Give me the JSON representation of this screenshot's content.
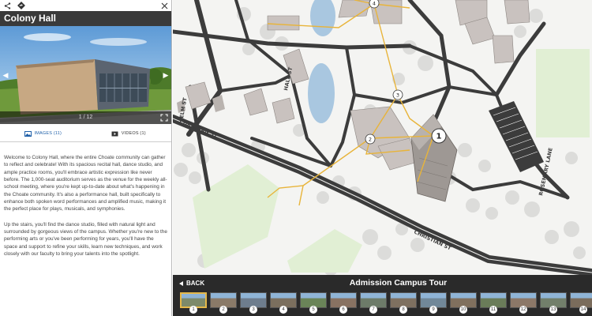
{
  "panel": {
    "title": "Colony Hall",
    "photo_counter": "1 / 12",
    "tabs": [
      {
        "label": "IMAGES (11)",
        "icon": "images-icon",
        "active": true
      },
      {
        "label": "VIDEOS (1)",
        "icon": "video-icon",
        "active": false
      }
    ],
    "paragraphs": [
      "Welcome to Colony Hall, where the entire Choate community can gather to reflect and celebrate! With its spacious recital hall, dance studio, and ample practice rooms, you'll embrace artistic expression like never before. The 1,000-seat auditorium serves as the venue for the weekly all-school meeting, where you're kept up-to-date about what's happening in the Choate community. It's also a performance hall, built specifically to enhance both spoken word performances and amplified music, making it the perfect place for plays, musicals, and symphonies.",
      "Up the stairs, you'll find the dance studio, filled with natural light and surrounded by gorgeous views of the campus. Whether you're new to the performing arts or you've been performing for years, you'll have the space and support to refine your skills, learn new techniques, and work closely with our faculty to bring your talents into the spotlight."
    ]
  },
  "map": {
    "streets": [
      "ELM ST",
      "CHRISTIAN ST",
      "CHRISTIAN ST",
      "ROSEMARY LANE",
      "HALL ST"
    ],
    "markers": [
      "1",
      "2",
      "3",
      "4"
    ],
    "colors": {
      "route": "#e8b43a",
      "water": "#a9c7e0",
      "field": "#e1efd4",
      "road": "#3c3c3c"
    }
  },
  "tour": {
    "back_label": "BACK",
    "title": "Admission Campus Tour",
    "stops": [
      "1",
      "2",
      "3",
      "4",
      "5",
      "6",
      "7",
      "8",
      "9",
      "10",
      "11",
      "12",
      "13",
      "14"
    ],
    "active_stop": "1"
  }
}
